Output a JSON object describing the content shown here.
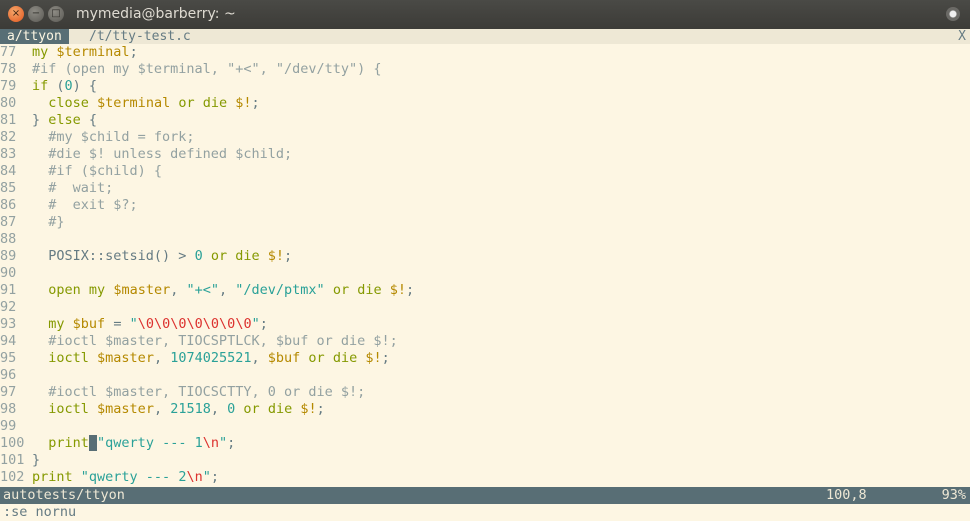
{
  "window": {
    "title": "mymedia@barberry: ~",
    "close_glyph": "×",
    "minimize_glyph": "−",
    "maximize_glyph": "□"
  },
  "tabline": {
    "tabs": [
      {
        "label": "a/ttyon",
        "active": true
      },
      {
        "label": "/t/tty-test.c",
        "active": false
      }
    ],
    "close_label": "X"
  },
  "editor": {
    "lines": [
      {
        "num": "77",
        "text": "my $terminal;"
      },
      {
        "num": "78",
        "text": "#if (open my $terminal, \"+<\", \"/dev/tty\") {"
      },
      {
        "num": "79",
        "text": "if (0) {"
      },
      {
        "num": "80",
        "text": "  close $terminal or die $!;"
      },
      {
        "num": "81",
        "text": "} else {"
      },
      {
        "num": "82",
        "text": "  #my $child = fork;"
      },
      {
        "num": "83",
        "text": "  #die $! unless defined $child;"
      },
      {
        "num": "84",
        "text": "  #if ($child) {"
      },
      {
        "num": "85",
        "text": "  #  wait;"
      },
      {
        "num": "86",
        "text": "  #  exit $?;"
      },
      {
        "num": "87",
        "text": "  #}"
      },
      {
        "num": "88",
        "text": ""
      },
      {
        "num": "89",
        "text": "  POSIX::setsid() > 0 or die $!;"
      },
      {
        "num": "90",
        "text": ""
      },
      {
        "num": "91",
        "text": "  open my $master, \"+<\", \"/dev/ptmx\" or die $!;"
      },
      {
        "num": "92",
        "text": ""
      },
      {
        "num": "93",
        "text": "  my $buf = \"\\0\\0\\0\\0\\0\\0\\0\";"
      },
      {
        "num": "94",
        "text": "  #ioctl $master, TIOCSPTLCK, $buf or die $!;"
      },
      {
        "num": "95",
        "text": "  ioctl $master, 1074025521, $buf or die $!;"
      },
      {
        "num": "96",
        "text": ""
      },
      {
        "num": "97",
        "text": "  #ioctl $master, TIOCSCTTY, 0 or die $!;"
      },
      {
        "num": "98",
        "text": "  ioctl $master, 21518, 0 or die $!;"
      },
      {
        "num": "99",
        "text": ""
      },
      {
        "num": "100",
        "text": "  print \"qwerty --- 1\\n\";"
      },
      {
        "num": "101",
        "text": "}"
      },
      {
        "num": "102",
        "text": "print \"qwerty --- 2\\n\";"
      }
    ],
    "cursor": {
      "line": "100",
      "col": 8
    }
  },
  "statusline": {
    "file": "autotests/ttyon",
    "position": "100,8",
    "percent": "93%"
  },
  "cmdline": {
    "text": ":se nornu"
  },
  "colors": {
    "background": "#fdf6e3",
    "keyword": "#859900",
    "variable": "#b58900",
    "number": "#2aa198",
    "string": "#2aa198",
    "escape": "#dc322f",
    "comment": "#93a1a1",
    "statusline": "#586e75"
  }
}
